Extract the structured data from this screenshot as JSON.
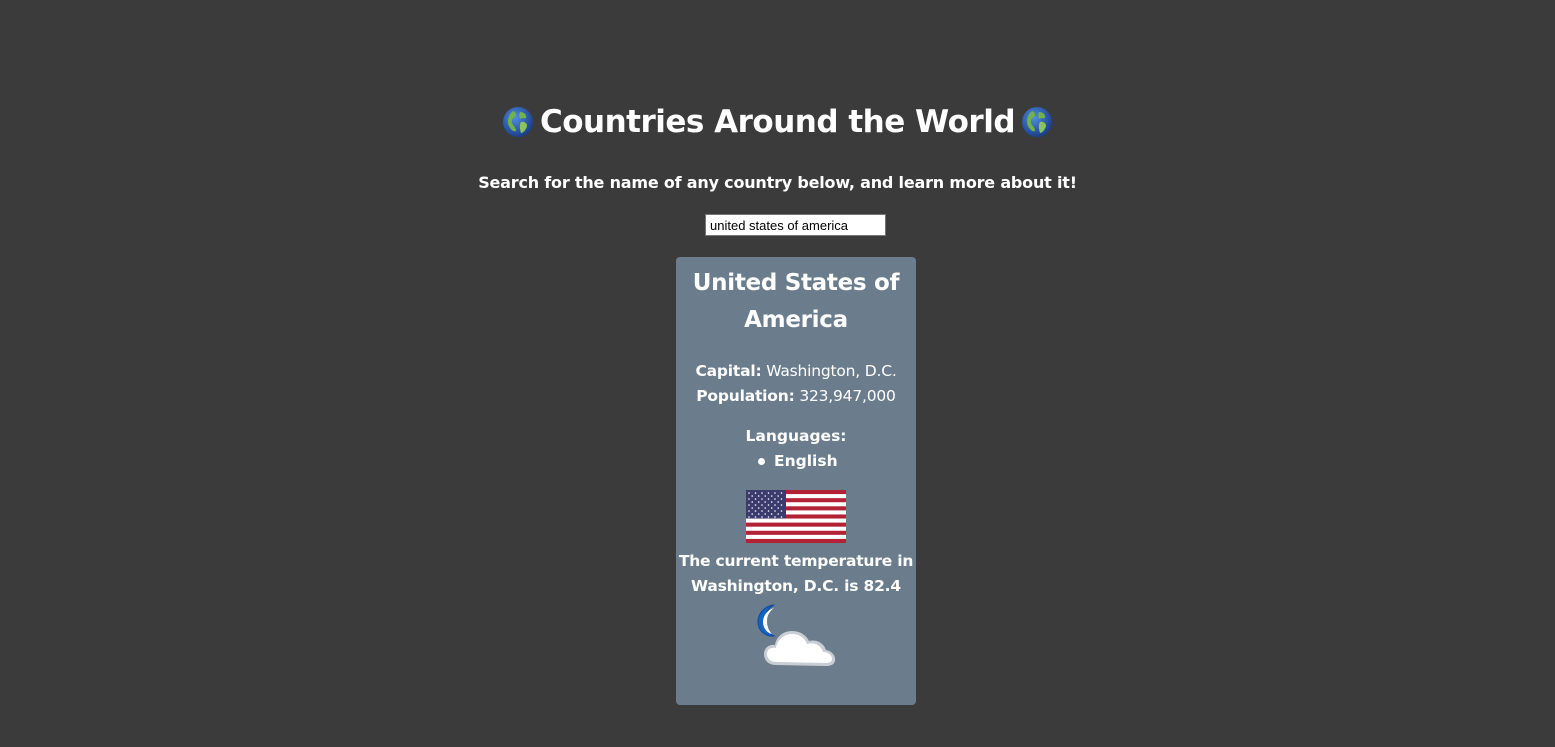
{
  "header": {
    "title": "Countries Around the World",
    "left_icon": "globe-icon",
    "right_icon": "globe-icon",
    "subtitle": "Search for the name of any country below, and learn more about it!"
  },
  "search": {
    "value": "united states of america"
  },
  "country": {
    "name": "United States of America",
    "capital_label": "Capital:",
    "capital": "Washington, D.C.",
    "population_label": "Population:",
    "population": "323,947,000",
    "languages_label": "Languages:",
    "languages": [
      "English"
    ],
    "flag_icon": "us-flag-icon",
    "temperature_text": "The current temperature in Washington, D.C. is 82.4",
    "weather_icon": "moon-cloud-icon"
  },
  "colors": {
    "background": "#3b3b3b",
    "card": "#6b7d8c",
    "text": "#ffffff"
  }
}
